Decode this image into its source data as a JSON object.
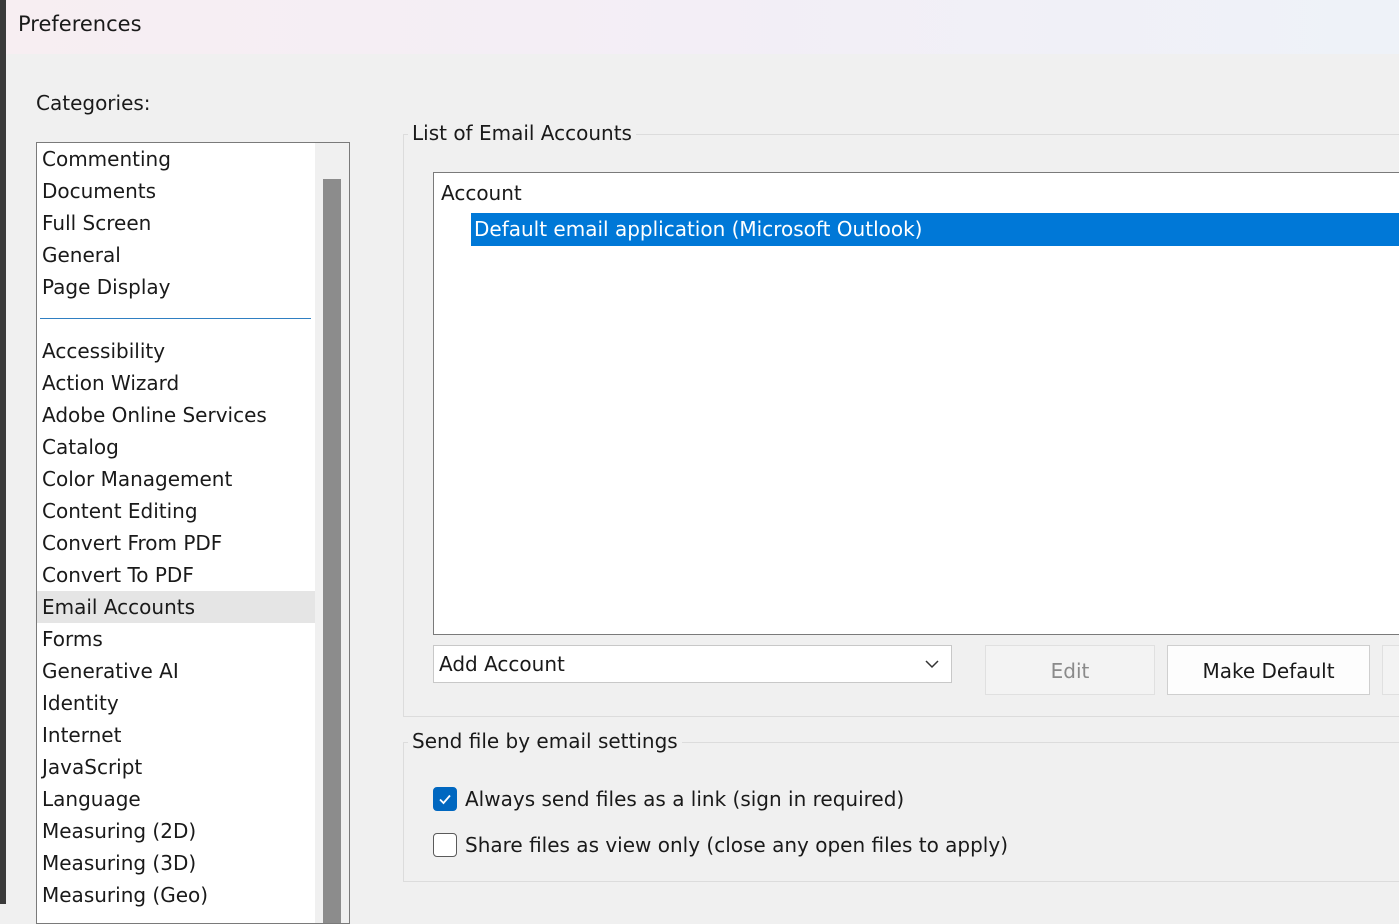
{
  "window": {
    "title": "Preferences"
  },
  "categories": {
    "label": "Categories:",
    "group_top": [
      "Commenting",
      "Documents",
      "Full Screen",
      "General",
      "Page Display"
    ],
    "group_bottom": [
      "Accessibility",
      "Action Wizard",
      "Adobe Online Services",
      "Catalog",
      "Color Management",
      "Content Editing",
      "Convert From PDF",
      "Convert To PDF",
      "Email Accounts",
      "Forms",
      "Generative AI",
      "Identity",
      "Internet",
      "JavaScript",
      "Language",
      "Measuring (2D)",
      "Measuring (3D)",
      "Measuring (Geo)"
    ],
    "selected": "Email Accounts"
  },
  "email_accounts": {
    "group_title": "List of Email Accounts",
    "column_header": "Account",
    "rows": [
      "Default email application (Microsoft Outlook)"
    ],
    "add_account_label": "Add Account",
    "edit_label": "Edit",
    "make_default_label": "Make Default"
  },
  "send_settings": {
    "group_title": "Send file by email settings",
    "option1": {
      "label": "Always send files as a link (sign in required)",
      "checked": true
    },
    "option2": {
      "label": "Share files as view only (close any open files to apply)",
      "checked": false
    }
  },
  "colors": {
    "accent": "#0078d7",
    "checkbox": "#0067c0"
  }
}
